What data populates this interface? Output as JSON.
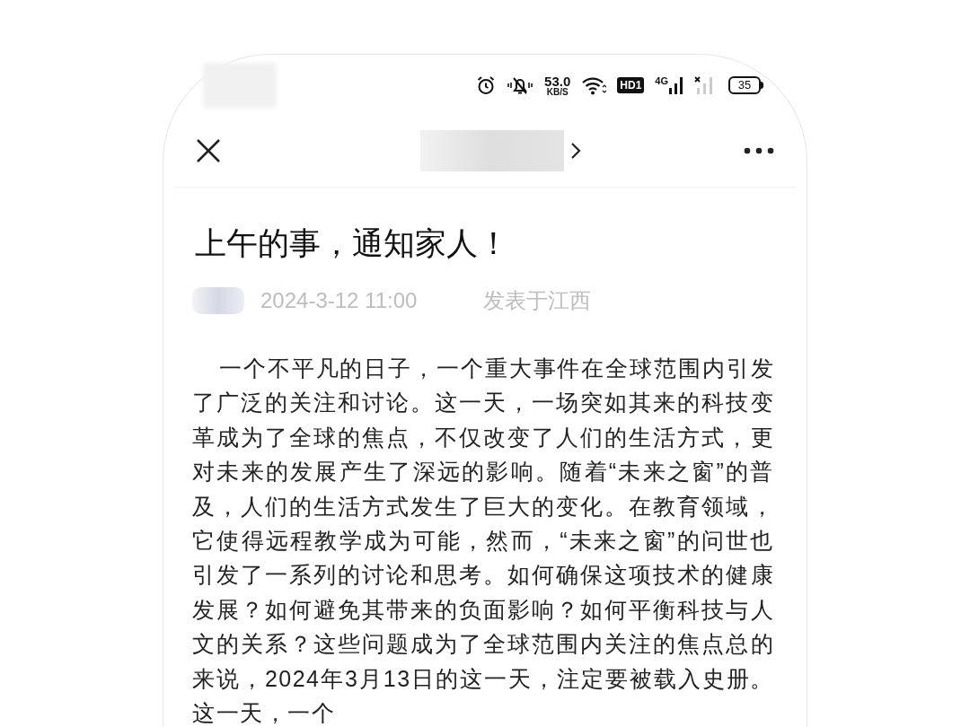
{
  "status_bar": {
    "speed": "53.0",
    "speed_unit": "KB/S",
    "hd_badge": "HD1",
    "network_type": "4G",
    "battery": "35"
  },
  "article": {
    "title": "上午的事，通知家人！",
    "date": "2024-3-12 11:00",
    "location": "发表于江西",
    "paragraph": "一个不平凡的日子，一个重大事件在全球范围内引发了广泛的关注和讨论。这一天，一场突如其来的科技变革成为了全球的焦点，不仅改变了人们的生活方式，更对未来的发展产生了深远的影响。随着“未来之窗”的普及，人们的生活方式发生了巨大的变化。在教育领域，它使得远程教学成为可能，然而，“未来之窗”的问世也引发了一系列的讨论和思考。如何确保这项技术的健康发展？如何避免其带来的负面影响？如何平衡科技与人文的关系？这些问题成为了全球范围内关注的焦点总的来说，2024年3月13日的这一天，注定要被载入史册。这一天，一个"
  }
}
